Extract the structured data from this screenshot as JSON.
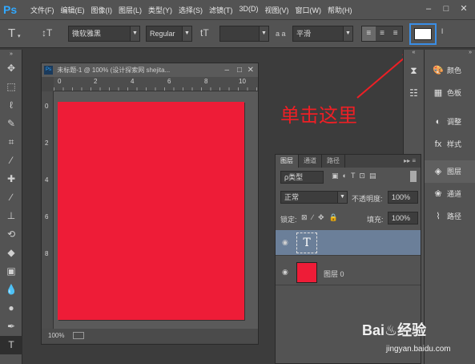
{
  "app": {
    "logo": "Ps"
  },
  "menu": [
    "文件(F)",
    "编辑(E)",
    "图像(I)",
    "图层(L)",
    "类型(Y)",
    "选择(S)",
    "滤镜(T)",
    "3D(D)",
    "视图(V)",
    "窗口(W)",
    "帮助(H)"
  ],
  "window_controls": [
    "–",
    "□",
    "✕"
  ],
  "options_bar": {
    "tool_icon": "T",
    "orientation_icon": "↕T",
    "font_family": "微软雅黑",
    "font_style": "Regular",
    "size_icon": "tT",
    "size_value": "",
    "aa_icon": "a a",
    "antialias": "平滑",
    "color_swatch": "#ffffff",
    "highlight_color": "#3a8ee6"
  },
  "document": {
    "title": "未标题-1 @ 100% (设计探索网 shejita...",
    "zoom": "100%",
    "canvas_color": "#ee1c37",
    "ruler_marks": [
      "0",
      "2",
      "4",
      "6",
      "8",
      "10"
    ],
    "vruler_marks": [
      "0",
      "2",
      "4",
      "6",
      "8"
    ]
  },
  "annotation": {
    "text": "单击这里",
    "color": "#ee1f25"
  },
  "right_panel": [
    {
      "icon": "palette-icon",
      "glyph": "🎨",
      "label": "颜色"
    },
    {
      "icon": "swatches-icon",
      "glyph": "▦",
      "label": "色板"
    },
    {
      "icon": "adjustments-icon",
      "glyph": "◐",
      "label": "调整"
    },
    {
      "icon": "styles-icon",
      "glyph": "fx",
      "label": "样式"
    },
    {
      "icon": "layers-icon",
      "glyph": "◈",
      "label": "图层"
    },
    {
      "icon": "channels-icon",
      "glyph": "❀",
      "label": "通道"
    },
    {
      "icon": "paths-icon",
      "glyph": "⌇",
      "label": "路径"
    }
  ],
  "layers_panel": {
    "tabs": [
      "图层",
      "通道",
      "路径"
    ],
    "filter_label": "ρ类型",
    "blend_mode": "正常",
    "opacity_label": "不透明度:",
    "opacity_value": "100%",
    "lock_label": "锁定:",
    "fill_label": "填充:",
    "fill_value": "100%",
    "layers": [
      {
        "name": "",
        "type": "text",
        "thumb": "T",
        "selected": true
      },
      {
        "name": "图层 0",
        "type": "raster",
        "thumb_color": "#ee1c37",
        "selected": false
      }
    ]
  },
  "watermark": {
    "brand": "Bai♨经验",
    "url": "jingyan.baidu.com"
  }
}
